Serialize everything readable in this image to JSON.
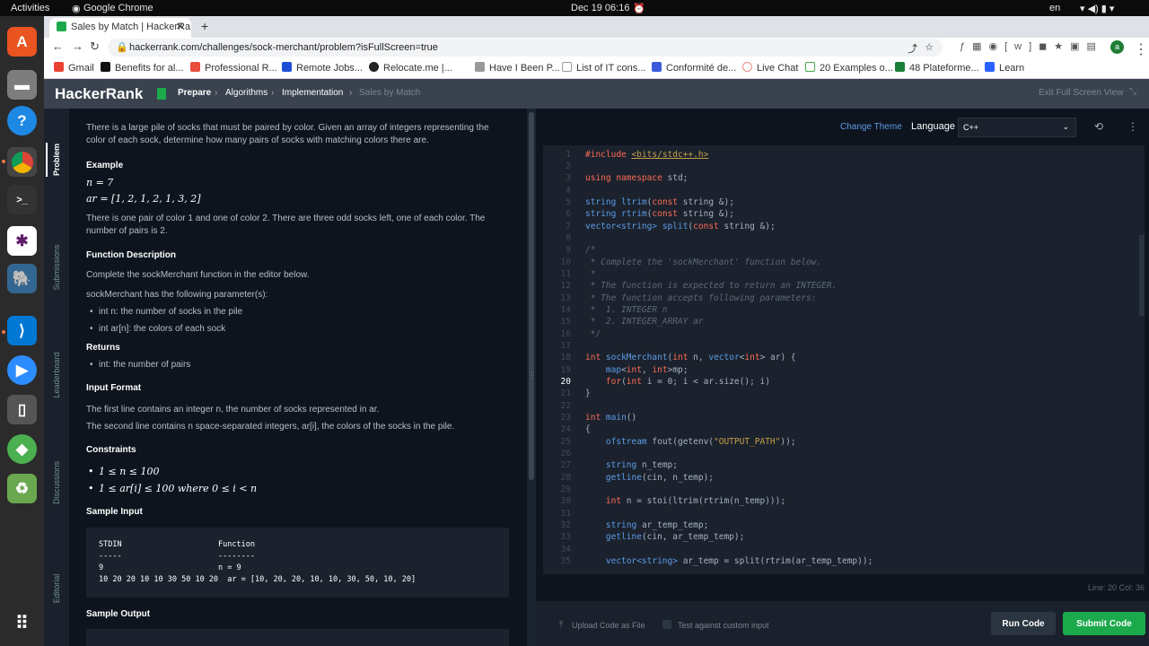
{
  "os": {
    "activities": "Activities",
    "app": "Google Chrome",
    "clock": "Dec 19  06:16",
    "lang": "en"
  },
  "browser": {
    "tab_title": "Sales by Match | HackerRa",
    "url": "hackerrank.com/challenges/sock-merchant/problem?isFullScreen=true",
    "bookmarks": [
      "Gmail",
      "Benefits for al...",
      "Professional R...",
      "Remote Jobs...",
      "Relocate.me |...",
      "Have I Been P...",
      "List of IT cons...",
      "Conformité de...",
      "Live Chat",
      "20 Examples o...",
      "48 Plateforme...",
      "Learn"
    ]
  },
  "header": {
    "logo": "HackerRank",
    "crumbs": [
      "Prepare",
      "Algorithms",
      "Implementation",
      "Sales by Match"
    ],
    "exit": "Exit Full Screen View"
  },
  "rail": [
    "Problem",
    "Submissions",
    "Leaderboard",
    "Discussions",
    "Editorial"
  ],
  "problem": {
    "intro": "There is a large pile of socks that must be paired by color. Given an array of integers representing the color of each sock, determine how many pairs of socks with matching colors there are.",
    "example_h": "Example",
    "ex_n": "n = 7",
    "ex_ar": "ar = [1, 2, 1, 2, 1, 3, 2]",
    "ex_text": "There is one pair of color 1 and one of color 2. There are three odd socks left, one of each color. The number of pairs is 2.",
    "fd_h": "Function Description",
    "fd_1": "Complete the sockMerchant function in the editor below.",
    "fd_2": "sockMerchant has the following parameter(s):",
    "param1": "int n: the number of socks in the pile",
    "param2": "int ar[n]: the colors of each sock",
    "ret_h": "Returns",
    "ret1": "int: the number of pairs",
    "if_h": "Input Format",
    "if1": "The first line contains an integer n, the number of socks represented in ar.",
    "if2": "The second line contains n space-separated integers, ar[i], the colors of the socks in the pile.",
    "con_h": "Constraints",
    "con1": "1 ≤ n ≤ 100",
    "con2": "1 ≤ ar[i] ≤ 100 where 0 ≤ i < n",
    "si_h": "Sample Input",
    "si_l1": "STDIN                     Function",
    "si_l2": "-----                     --------",
    "si_l3": "9                         n = 9",
    "si_l4": "10 20 20 10 10 30 50 10 20  ar = [10, 20, 20, 10, 10, 30, 50, 10, 20]",
    "so_h": "Sample Output"
  },
  "editor": {
    "change_theme": "Change Theme",
    "language_label": "Language",
    "language": "C++",
    "status": "Line: 20  Col: 36",
    "upload": "Upload Code as File",
    "custom": "Test against custom input",
    "run": "Run Code",
    "submit": "Submit Code"
  }
}
